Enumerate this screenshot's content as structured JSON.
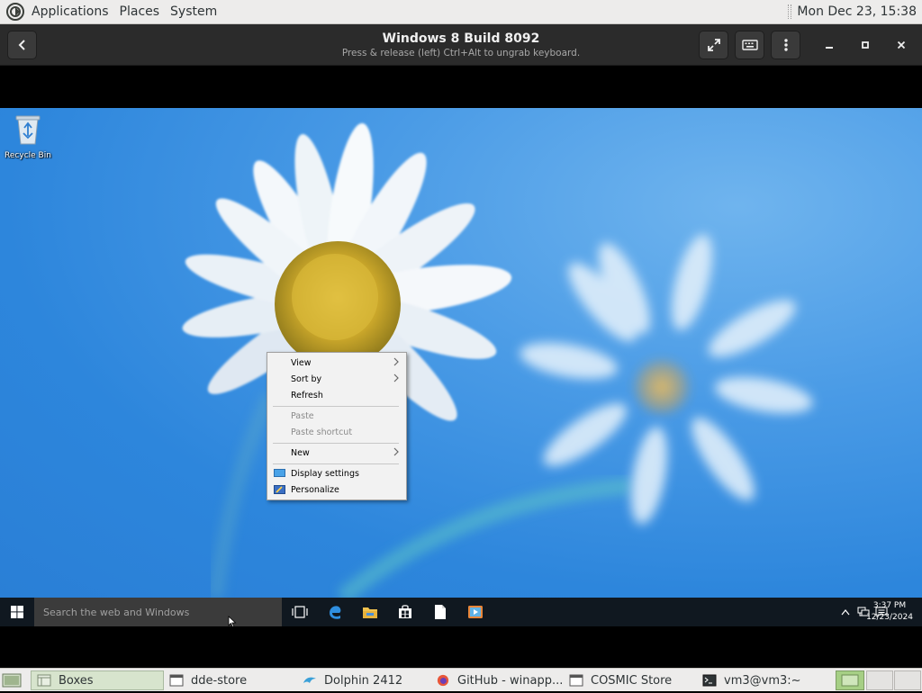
{
  "top_panel": {
    "menus": [
      "Applications",
      "Places",
      "System"
    ],
    "clock": "Mon Dec 23, 15:38"
  },
  "headerbar": {
    "title": "Windows 8 Build 8092",
    "subtitle": "Press & release (left) Ctrl+Alt to ungrab keyboard."
  },
  "desktop": {
    "icons": [
      {
        "label": "Recycle Bin",
        "icon": "recycle-bin-icon"
      }
    ]
  },
  "context_menu": {
    "items": [
      {
        "label": "View",
        "submenu": true
      },
      {
        "label": "Sort by",
        "submenu": true
      },
      {
        "label": "Refresh"
      },
      {
        "label": "Paste",
        "disabled": true
      },
      {
        "label": "Paste shortcut",
        "disabled": true
      },
      {
        "label": "New",
        "submenu": true
      },
      {
        "label": "Display settings",
        "icon": "display-icon"
      },
      {
        "label": "Personalize",
        "icon": "personalize-icon"
      }
    ]
  },
  "win_taskbar": {
    "search_placeholder": "Search the web and Windows",
    "time": "3:37 PM",
    "date": "12/23/2024",
    "pinned": [
      "task-view-icon",
      "edge-icon",
      "file-explorer-icon",
      "store-icon",
      "document-icon",
      "media-player-icon"
    ]
  },
  "bottom_panel": {
    "tasks": [
      {
        "label": "Boxes",
        "active": true
      },
      {
        "label": "dde-store"
      },
      {
        "label": "Dolphin 2412"
      },
      {
        "label": "GitHub - winapp..."
      },
      {
        "label": "COSMIC Store"
      },
      {
        "label": "vm3@vm3:~"
      }
    ]
  },
  "colors": {
    "desktop_blue": "#2d86dc",
    "workspace_active": "#a6cf85",
    "headerbar": "#2b2b2b"
  }
}
